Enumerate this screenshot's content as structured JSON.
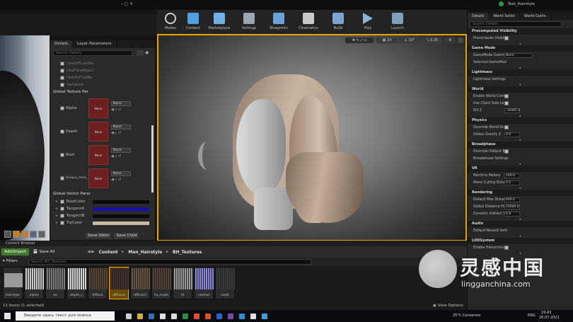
{
  "window": {
    "title": "Test_Hairstyle"
  },
  "toolbar": {
    "items": [
      {
        "label": "Modes",
        "icon": "modes-icon",
        "color": "#d8d8d8"
      },
      {
        "label": "Content",
        "icon": "content-icon",
        "color": "#4f9ede"
      },
      {
        "label": "Marketplace",
        "icon": "marketplace-icon",
        "color": "#6fb0e6"
      },
      {
        "label": "Settings",
        "icon": "settings-icon",
        "color": "#9aa7b3"
      },
      {
        "label": "Blueprints",
        "icon": "blueprints-icon",
        "color": "#6aa3d8"
      },
      {
        "label": "Cinematics",
        "icon": "cinematics-icon",
        "color": "#c9c9c9"
      },
      {
        "label": "Build",
        "icon": "build-icon",
        "color": "#7aa7d0"
      },
      {
        "label": "Play",
        "icon": "play-icon",
        "color": "#8ab3d9"
      },
      {
        "label": "Launch",
        "icon": "launch-icon",
        "color": "#7e9fbd"
      }
    ]
  },
  "details_panel": {
    "tabs": [
      "Details",
      "Layer Parameters"
    ],
    "search_placeholder": "Search Details",
    "rows_top": [
      "UseDiffuseMa",
      "UseFlowMap2",
      "UseUtilTxtMa",
      "Variation"
    ],
    "section_texture": "Global Texture Par",
    "textures": [
      {
        "name": "Alpha",
        "tex": "None",
        "dd": "None"
      },
      {
        "name": "Depth",
        "tex": "None",
        "dd": "None"
      },
      {
        "name": "Root",
        "tex": "None",
        "dd": "None"
      },
      {
        "name": "Unique_main_L",
        "tex": "None",
        "dd": "None"
      }
    ],
    "section_vector": "Global Vector Parar",
    "vectors": [
      {
        "name": "RootColor",
        "color": "#0a0a0a"
      },
      {
        "name": "TangentA",
        "color": "#1a0ea8"
      },
      {
        "name": "TangentB",
        "color": "#0a0a0a"
      },
      {
        "name": "TipColor",
        "color": "#c9b9a6"
      }
    ],
    "save_sibling": "Save Siblin",
    "save_child": "Save Child"
  },
  "viewport": {
    "grid_snap": "10",
    "rot_snap": "10°",
    "scale_snap": "0.25",
    "cam_speed": "4"
  },
  "right_panel": {
    "tabs": [
      "Details",
      "World Settin",
      "World Outlin"
    ],
    "search_placeholder": "Search Details",
    "sections": [
      {
        "title": "Precomputed Visibility",
        "rows": [
          {
            "label": "Precompute Visibili",
            "type": "check"
          }
        ]
      },
      {
        "title": "Game Mode",
        "rows": [
          {
            "label": "GameMode Overrid",
            "type": "dropdown",
            "value": "None"
          },
          {
            "label": "Selected GameMod",
            "type": "text"
          }
        ]
      },
      {
        "title": "Lightmass",
        "rows": [
          {
            "label": "Lightmass Settings",
            "type": "text"
          }
        ]
      },
      {
        "title": "World",
        "rows": [
          {
            "label": "Enable World Compo",
            "type": "check"
          },
          {
            "label": "Use Client Side Leve",
            "type": "check"
          },
          {
            "label": "Kill Z",
            "type": "value",
            "value": "-10485.0"
          }
        ]
      },
      {
        "title": "Physics",
        "rows": [
          {
            "label": "Override World Grav",
            "type": "check"
          },
          {
            "label": "Global Gravity Z",
            "type": "value",
            "value": "0.0"
          }
        ]
      },
      {
        "title": "Broadphase",
        "rows": [
          {
            "label": "Override Default Bro",
            "type": "check"
          },
          {
            "label": "Broadphase Settings",
            "type": "text"
          }
        ]
      },
      {
        "title": "VR",
        "rows": [
          {
            "label": "World to Meters",
            "type": "value",
            "value": "100.0"
          },
          {
            "label": "Mono Culling Distan",
            "type": "value",
            "value": "0.0"
          }
        ]
      },
      {
        "title": "Rendering",
        "rows": [
          {
            "label": "Default Max Distanc",
            "type": "value",
            "value": "600.0"
          },
          {
            "label": "Global Distance Field",
            "type": "value",
            "value": "20000.0"
          },
          {
            "label": "Dynamic Indirect Sh",
            "type": "value",
            "value": "0.8"
          }
        ]
      },
      {
        "title": "Audio",
        "rows": [
          {
            "label": "Default Reverb Setti",
            "type": "text"
          }
        ]
      },
      {
        "title": "LODSystem",
        "rows": [
          {
            "label": "Enable Hierarchical",
            "type": "check"
          }
        ]
      }
    ]
  },
  "content_browser": {
    "tab": "Content Browser",
    "add_import": "Add/Import",
    "save_all": "Save All",
    "path": [
      "Content",
      "Man_Hairstyle",
      "BH_Textures"
    ],
    "filters": "Filters",
    "search_placeholder": "Search BH_Textures",
    "assets": [
      {
        "name": "Hairstyle",
        "color": "#9a9a9a",
        "kind": "folder"
      },
      {
        "name": "alpha",
        "color": "#c9c9c9"
      },
      {
        "name": "ao",
        "color": "#7a7a7a"
      },
      {
        "name": "depth_c",
        "color": "#d7d7d7"
      },
      {
        "name": "diffuse",
        "color": "#5a4334"
      },
      {
        "name": "diffuse2",
        "color": "#3e3027"
      },
      {
        "name": "diffuse3",
        "color": "#6a5242"
      },
      {
        "name": "ha_mask",
        "color": "#534037"
      },
      {
        "name": "id",
        "color": "#9b9b9b"
      },
      {
        "name": "normal",
        "color": "#8b87e3"
      },
      {
        "name": "roots",
        "color": "#3a3a3a"
      }
    ],
    "selected_index": 5,
    "status": "11 items (1 selected)",
    "view_options": "View Options"
  },
  "taskbar": {
    "search_placeholder": "Введите здесь текст для поиска",
    "weather": "25°C Солнечно",
    "lang": "ENG",
    "time": "19:43",
    "date": "26.07.2021"
  },
  "watermark": {
    "title": "灵感中国",
    "url": "lingganchina.com"
  }
}
